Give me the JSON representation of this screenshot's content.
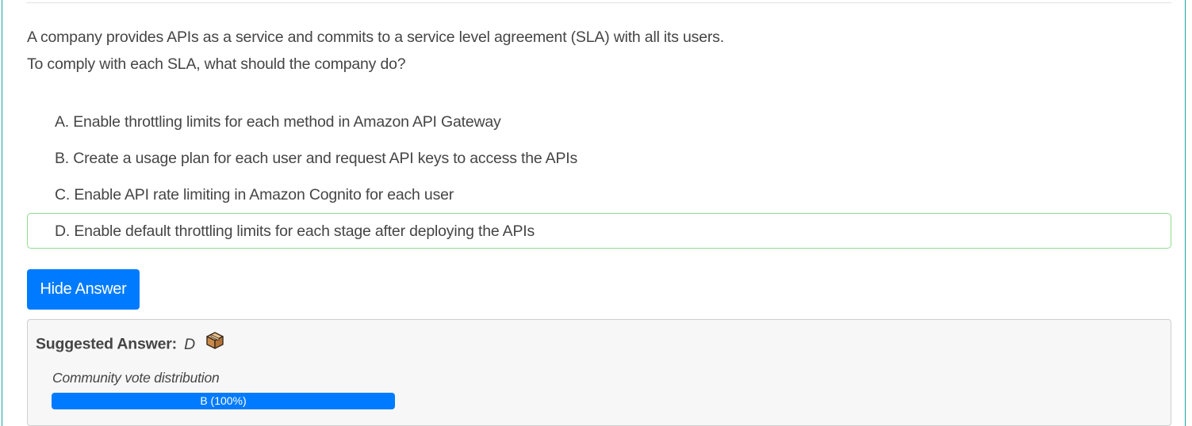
{
  "question": {
    "line1": "A company provides APIs as a service and commits to a service level agreement (SLA) with all its users.",
    "line2": "To comply with each SLA, what should the company do?"
  },
  "choices": [
    {
      "letter": "A",
      "text": "A. Enable throttling limits for each method in Amazon API Gateway"
    },
    {
      "letter": "B",
      "text": "B. Create a usage plan for each user and request API keys to access the APIs"
    },
    {
      "letter": "C",
      "text": "C. Enable API rate limiting in Amazon Cognito for each user"
    },
    {
      "letter": "D",
      "text": "D. Enable default throttling limits for each stage after deploying the APIs",
      "highlighted": true
    }
  ],
  "toggle_button": {
    "label": "Hide Answer"
  },
  "suggested_answer": {
    "label": "Suggested Answer:",
    "value": "D",
    "icon": "box-icon"
  },
  "community_vote": {
    "label": "Community vote distribution",
    "bars": [
      {
        "choice": "B",
        "percent": 100,
        "text": "B (100%)"
      }
    ]
  },
  "colors": {
    "accent": "#007bff",
    "correct_border": "#8fdc8f",
    "card_border": "#1aa3a3"
  }
}
